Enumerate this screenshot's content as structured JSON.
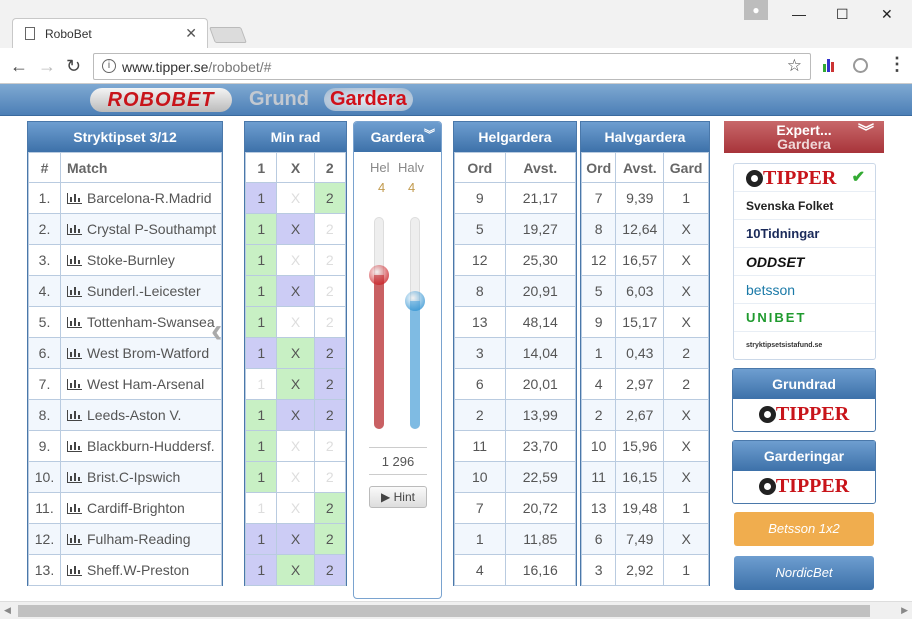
{
  "browser": {
    "tab_title": "RoboBet",
    "url_host": "www.tipper.se",
    "url_path": "/robobet/#"
  },
  "site": {
    "logo": "ROBOBET",
    "nav_grund": "Grund",
    "nav_gardera": "Gardera"
  },
  "match_panel": {
    "title": "Stryktipset 3/12",
    "col_num": "#",
    "col_match": "Match",
    "rows": [
      {
        "n": "1.",
        "name": "Barcelona-R.Madrid"
      },
      {
        "n": "2.",
        "name": "Crystal P-Southampt"
      },
      {
        "n": "3.",
        "name": "Stoke-Burnley"
      },
      {
        "n": "4.",
        "name": "Sunderl.-Leicester"
      },
      {
        "n": "5.",
        "name": "Tottenham-Swansea"
      },
      {
        "n": "6.",
        "name": "West Brom-Watford"
      },
      {
        "n": "7.",
        "name": "West Ham-Arsenal"
      },
      {
        "n": "8.",
        "name": "Leeds-Aston V."
      },
      {
        "n": "9.",
        "name": "Blackburn-Huddersf."
      },
      {
        "n": "10.",
        "name": "Brist.C-Ipswich"
      },
      {
        "n": "11.",
        "name": "Cardiff-Brighton"
      },
      {
        "n": "12.",
        "name": "Fulham-Reading"
      },
      {
        "n": "13.",
        "name": "Sheff.W-Preston"
      }
    ]
  },
  "minrad": {
    "title": "Min rad",
    "cols": [
      "1",
      "X",
      "2"
    ],
    "rows": [
      {
        "one": "1",
        "x": "X",
        "two": "2",
        "s": [
          "c1",
          "dim",
          "cX"
        ]
      },
      {
        "one": "1",
        "x": "X",
        "two": "2",
        "s": [
          "g1",
          "gX",
          "dim"
        ]
      },
      {
        "one": "1",
        "x": "X",
        "two": "2",
        "s": [
          "g1",
          "dim",
          "dim"
        ]
      },
      {
        "one": "1",
        "x": "X",
        "two": "2",
        "s": [
          "g1",
          "gX",
          "dim"
        ]
      },
      {
        "one": "1",
        "x": "X",
        "two": "2",
        "s": [
          "g1",
          "dim",
          "dim"
        ]
      },
      {
        "one": "1",
        "x": "X",
        "two": "2",
        "s": [
          "c1",
          "cX",
          "c1"
        ]
      },
      {
        "one": "1",
        "x": "X",
        "two": "2",
        "s": [
          "dim",
          "cX",
          "c1"
        ]
      },
      {
        "one": "1",
        "x": "X",
        "two": "2",
        "s": [
          "g1",
          "gX",
          "c1"
        ]
      },
      {
        "one": "1",
        "x": "X",
        "two": "2",
        "s": [
          "g1",
          "dim",
          "dim"
        ]
      },
      {
        "one": "1",
        "x": "X",
        "two": "2",
        "s": [
          "g1",
          "dim",
          "dim"
        ]
      },
      {
        "one": "1",
        "x": "X",
        "two": "2",
        "s": [
          "dim",
          "dim",
          "cX"
        ]
      },
      {
        "one": "1",
        "x": "X",
        "two": "2",
        "s": [
          "c1",
          "gX",
          "cX"
        ]
      },
      {
        "one": "1",
        "x": "X",
        "two": "2",
        "s": [
          "c1",
          "cX",
          "c1"
        ]
      }
    ]
  },
  "gardera": {
    "title": "Gardera",
    "hel_label": "Hel",
    "halv_label": "Halv",
    "hel_value": "4",
    "halv_value": "4",
    "hel_level": 0.18,
    "halv_level": 0.3,
    "rows_count": "1 296",
    "hint": "Hint",
    "red": "#c8141a",
    "blue": "#2a8fd0"
  },
  "helgardera": {
    "title": "Helgardera",
    "col_ord": "Ord",
    "col_avst": "Avst.",
    "rows": [
      [
        "9",
        "21,17"
      ],
      [
        "5",
        "19,27"
      ],
      [
        "12",
        "25,30"
      ],
      [
        "8",
        "20,91"
      ],
      [
        "13",
        "48,14"
      ],
      [
        "3",
        "14,04"
      ],
      [
        "6",
        "20,01"
      ],
      [
        "2",
        "13,99"
      ],
      [
        "11",
        "23,70"
      ],
      [
        "10",
        "22,59"
      ],
      [
        "7",
        "20,72"
      ],
      [
        "1",
        "11,85"
      ],
      [
        "4",
        "16,16"
      ]
    ]
  },
  "halvgardera": {
    "title": "Halvgardera",
    "col_ord": "Ord",
    "col_avst": "Avst.",
    "col_gard": "Gard",
    "rows": [
      [
        "7",
        "9,39",
        "1"
      ],
      [
        "8",
        "12,64",
        "X"
      ],
      [
        "12",
        "16,57",
        "X"
      ],
      [
        "5",
        "6,03",
        "X"
      ],
      [
        "9",
        "15,17",
        "X"
      ],
      [
        "1",
        "0,43",
        "2"
      ],
      [
        "4",
        "2,97",
        "2"
      ],
      [
        "2",
        "2,67",
        "X"
      ],
      [
        "10",
        "15,96",
        "X"
      ],
      [
        "11",
        "16,15",
        "X"
      ],
      [
        "13",
        "19,48",
        "1"
      ],
      [
        "6",
        "7,49",
        "X"
      ],
      [
        "3",
        "2,92",
        "1"
      ]
    ]
  },
  "expert": {
    "title": "Expert...",
    "subtitle": "Gardera",
    "brands": [
      "TIPPER",
      "Svenska Folket",
      "10Tidningar",
      "ODDSET",
      "betsson",
      "UNIBET",
      "stryktipsetsistafund.se"
    ]
  },
  "grundrad": {
    "title": "Grundrad",
    "brand": "TIPPER"
  },
  "garderingar": {
    "title": "Garderingar",
    "brand": "TIPPER"
  },
  "buttons": {
    "betsson": "Betsson 1x2",
    "nordicbet": "NordicBet"
  }
}
